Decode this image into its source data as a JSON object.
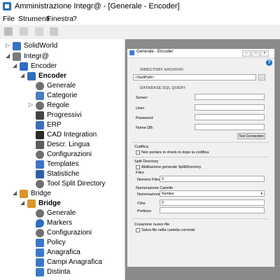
{
  "window": {
    "title": "Amministrazione Integr@ - [Generale - Encoder]"
  },
  "menu": [
    "File",
    "Strumenti",
    "Finestra",
    "?"
  ],
  "tree": [
    {
      "label": "SolidWorld",
      "icon": "solidworld-icon",
      "toggle": "▷",
      "color": "#3b74c4"
    },
    {
      "label": "Integr@",
      "icon": "integra-icon",
      "toggle": "◢",
      "color": "#7b7b7b"
    },
    {
      "label": "Encoder",
      "icon": "encoder-icon",
      "toggle": "◢",
      "color": "#2e6cc0"
    },
    {
      "label": "Encoder",
      "icon": "encoder-icon",
      "toggle": "◢",
      "color": "#2e6cc0",
      "bold": true
    },
    {
      "label": "Generale",
      "icon": "gear-icon",
      "toggle": "",
      "color": "#707070"
    },
    {
      "label": "Categorie",
      "icon": "categories-icon",
      "toggle": "",
      "color": "#4a7fc1"
    },
    {
      "label": "Regole",
      "icon": "gear-icon",
      "toggle": "▷",
      "color": "#707070"
    },
    {
      "label": "Progressivi",
      "icon": "progressive-icon",
      "toggle": "",
      "color": "#444444"
    },
    {
      "label": "ERP",
      "icon": "erp-icon",
      "toggle": "",
      "color": "#3d6fb8"
    },
    {
      "label": "CAD Integration",
      "icon": "cad-icon",
      "toggle": "",
      "color": "#2a2a2a"
    },
    {
      "label": "Descr. Lingua",
      "icon": "language-icon",
      "toggle": "",
      "color": "#5c5c5c"
    },
    {
      "label": "Configurazioni",
      "icon": "gear-icon",
      "toggle": "",
      "color": "#707070"
    },
    {
      "label": "Templates",
      "icon": "templates-icon",
      "toggle": "",
      "color": "#3e73c2"
    },
    {
      "label": "Statistiche",
      "icon": "statistics-icon",
      "toggle": "",
      "color": "#2f5fa8"
    },
    {
      "label": "Tool Split Directory",
      "icon": "gear-icon",
      "toggle": "",
      "color": "#707070"
    },
    {
      "label": "Bridge",
      "icon": "bridge-icon",
      "toggle": "◢",
      "color": "#d8962c"
    },
    {
      "label": "Bridge",
      "icon": "bridge-icon",
      "toggle": "◢",
      "color": "#d8962c",
      "bold": true
    },
    {
      "label": "Generale",
      "icon": "gear-icon",
      "toggle": "",
      "color": "#707070"
    },
    {
      "label": "Markers",
      "icon": "marker-icon",
      "toggle": "",
      "color": "#2f6cc2"
    },
    {
      "label": "Configurazioni",
      "icon": "gear-icon",
      "toggle": "",
      "color": "#707070"
    },
    {
      "label": "Policy",
      "icon": "policy-icon",
      "toggle": "",
      "color": "#3b78c8"
    },
    {
      "label": "Anagrafica",
      "icon": "registry-icon",
      "toggle": "",
      "color": "#3b78c8"
    },
    {
      "label": "Campi Anagrafica",
      "icon": "registry-fields-icon",
      "toggle": "",
      "color": "#3b78c8"
    },
    {
      "label": "Distinta",
      "icon": "bom-icon",
      "toggle": "",
      "color": "#3b78c8"
    }
  ],
  "dialog": {
    "title": "Generale - Encoder",
    "directory_archivio_label": "DIRECTORY ARCHIVIO",
    "vault_path": "<VaultPath>",
    "browse_label": "...",
    "database_label": "DATABASE SQL QUERY",
    "server_label": "Server:",
    "user_label": "User:",
    "password_label": "Password:",
    "nome_db_label": "Nome DB:",
    "test_connection_label": "Test Connection",
    "codifica_label": "Codifica",
    "non_portare_label": "Non portare in check in dopo la codifica",
    "split_directory_label": "Split Directory",
    "abilitazione_label": "Abilitazione generale SplitDirectory",
    "files_label": "Files",
    "numero_files_label": "Numero Files",
    "numero_files_value": "0",
    "numerazione_cartelle_label": "Numerazione Cartelle",
    "numerazione_label": "Numerazione",
    "numerazione_value": "Number",
    "cifre_label": "Cifre",
    "cifre_value": "0",
    "prefisso_label": "Prefisso",
    "creazione_label": "Creazione nuovo file",
    "salva_file_label": "Salva file nella cartella corrente"
  }
}
